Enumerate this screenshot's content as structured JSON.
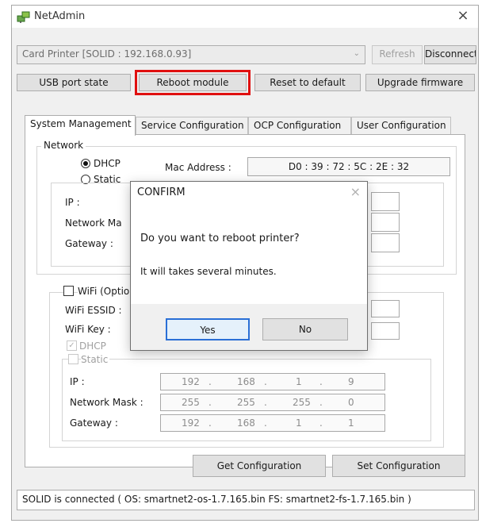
{
  "window": {
    "title": "NetAdmin",
    "close": "×"
  },
  "printer_select": {
    "value": "Card Printer  [SOLID : 192.168.0.93]",
    "refresh_label": "Refresh",
    "disconnect_label": "Disconnect"
  },
  "actions": {
    "usb_port_state": "USB port state",
    "reboot_module": "Reboot module",
    "reset_to_default": "Reset to default",
    "upgrade_firmware": "Upgrade firmware"
  },
  "tabs": [
    {
      "label": "System Management",
      "active": true
    },
    {
      "label": "Service Configuration",
      "active": false
    },
    {
      "label": "OCP Configuration",
      "active": false
    },
    {
      "label": "User Configuration",
      "active": false
    }
  ],
  "network": {
    "group_title": "Network",
    "dhcp_label": "DHCP",
    "static_label": "Static",
    "mac_label": "Mac Address :",
    "mac_value": "D0 : 39 : 72 : 5C : 2E : 32",
    "ip_label": "IP :",
    "mask_label": "Network Ma",
    "gateway_label": "Gateway :"
  },
  "wifi": {
    "checkbox_label": "WiFi (Optio",
    "essid_label": "WiFi ESSID :",
    "key_label": "WiFi Key :",
    "dhcp_label": "DHCP",
    "static_label": "Static",
    "ip_label": "IP :",
    "mask_label": "Network Mask :",
    "gateway_label": "Gateway :",
    "ip": [
      "192",
      "168",
      "1",
      "9"
    ],
    "mask": [
      "255",
      "255",
      "255",
      "0"
    ],
    "gateway": [
      "192",
      "168",
      "1",
      "1"
    ]
  },
  "config_buttons": {
    "get": "Get Configuration",
    "set": "Set Configuration"
  },
  "status": {
    "text": "SOLID is connected ( OS: smartnet2-os-1.7.165.bin  FS: smartnet2-fs-1.7.165.bin )"
  },
  "dialog": {
    "title": "CONFIRM",
    "close": "×",
    "message": "Do you want to reboot printer?",
    "detail": "It will takes several minutes.",
    "yes_label": "Yes",
    "no_label": "No"
  },
  "colors": {
    "highlight": "#e01010",
    "window_bg": "#f0f0f0",
    "button_bg": "#e1e1e1"
  }
}
